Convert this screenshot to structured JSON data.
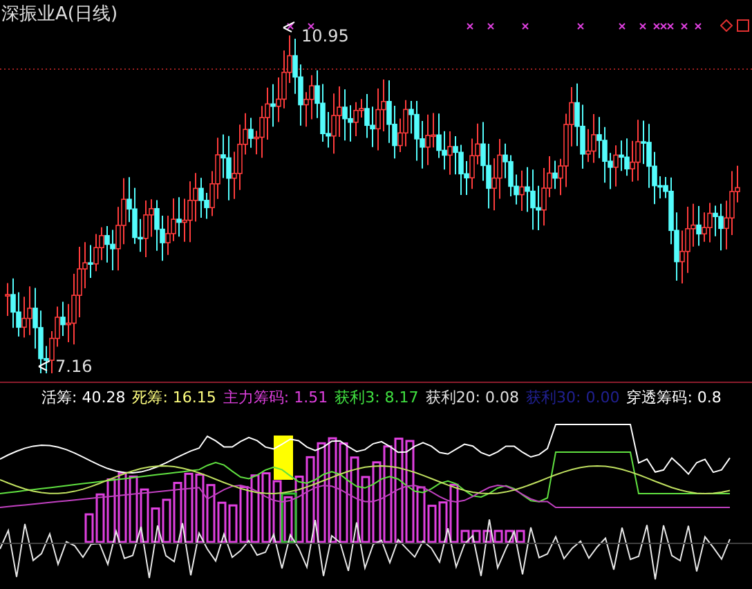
{
  "chart": {
    "title": "深振业A(日线)",
    "high_label": "10.95",
    "low_label": "7.16"
  },
  "indicator": {
    "legend": [
      {
        "text": "活筹: 40.28",
        "color": "#ffffff"
      },
      {
        "text": "死筹: 16.15",
        "color": "#ffff80"
      },
      {
        "text": "主力筹码: 1.51",
        "color": "#e040e0"
      },
      {
        "text": "获利3: 8.17",
        "color": "#40e040"
      },
      {
        "text": "获利20: 0.08",
        "color": "#e0e0e0"
      },
      {
        "text": "获利30: 0.00",
        "color": "#202090"
      },
      {
        "text": "穿透筹码: 0.8",
        "color": "#ffffff"
      }
    ]
  }
}
